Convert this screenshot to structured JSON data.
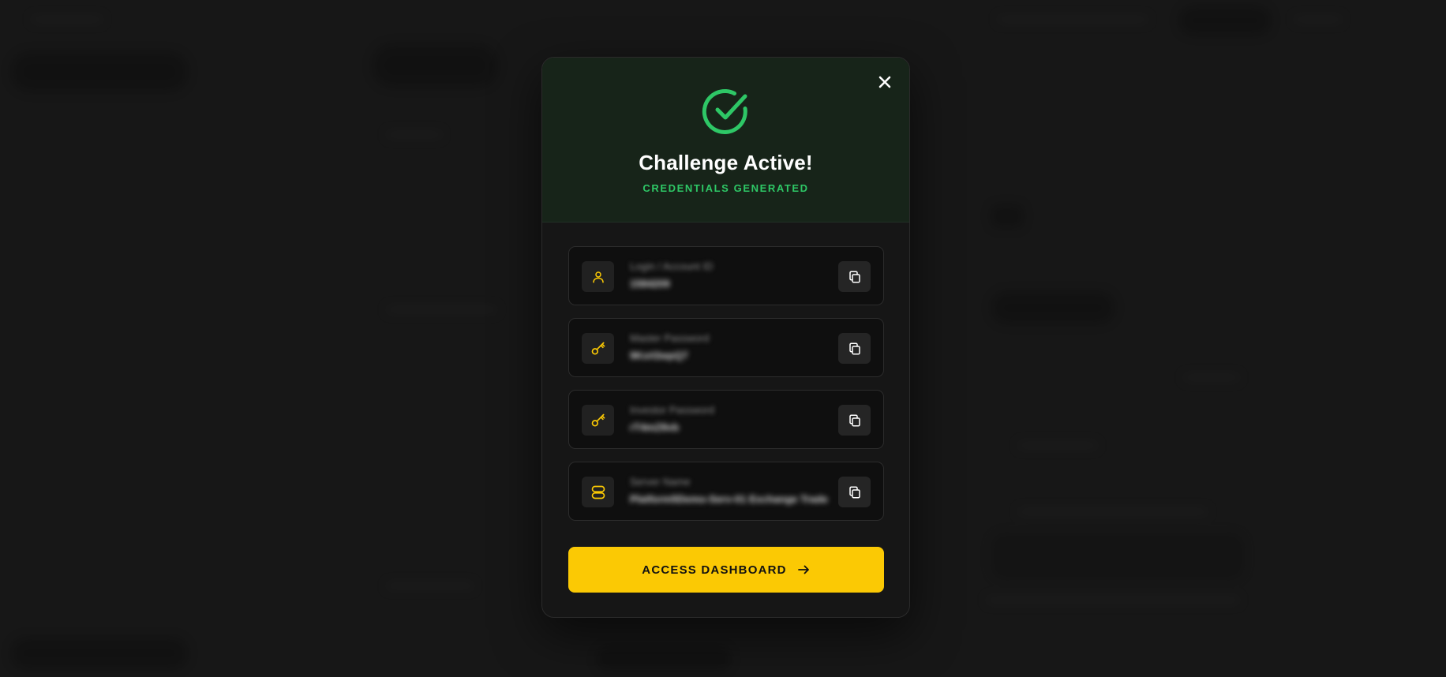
{
  "modal": {
    "title": "Challenge Active!",
    "subtitle": "CREDENTIALS GENERATED",
    "credentials": [
      {
        "icon": "user-icon",
        "label": "Login / Account ID",
        "value": "1584209"
      },
      {
        "icon": "key-icon",
        "label": "Master Password",
        "value": "9Kx#2wpQ7"
      },
      {
        "icon": "key-icon",
        "label": "Investor Password",
        "value": "rT4mZ8vb"
      },
      {
        "icon": "server-icon",
        "label": "Server Name",
        "value": "Platform5Demo-Serv-01 Exchange Trade"
      }
    ],
    "cta_label": "ACCESS DASHBOARD"
  },
  "colors": {
    "accent": "#fbc904",
    "success": "#2ec766",
    "header_bg": "#172419",
    "modal_bg": "#161616"
  }
}
